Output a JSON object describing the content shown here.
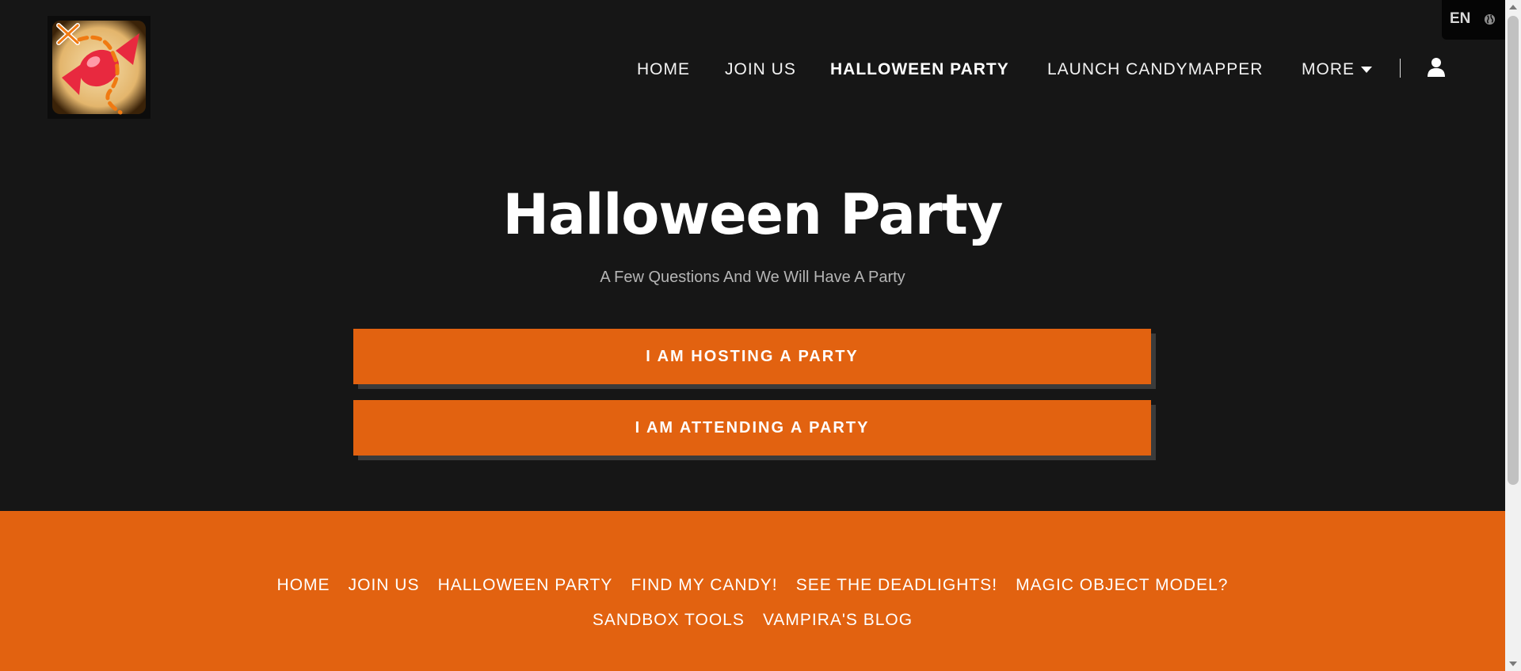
{
  "header": {
    "logo_icon": "candy-map-logo-icon",
    "nav": {
      "home": "HOME",
      "join_us": "JOIN US",
      "halloween_party": "HALLOWEEN PARTY",
      "launch": "LAUNCH CANDYMAPPER",
      "more": "MORE"
    },
    "active_item": "HALLOWEEN PARTY",
    "account_icon": "user-icon",
    "language": {
      "label": "EN",
      "icon": "globe-icon"
    }
  },
  "hero": {
    "title": "Halloween Party",
    "subtitle": "A Few Questions And We Will Have A Party",
    "buttons": {
      "host": "I AM HOSTING A PARTY",
      "attend": "I AM ATTENDING A PARTY"
    }
  },
  "footer": {
    "links_row1": [
      "HOME",
      "JOIN US",
      "HALLOWEEN PARTY",
      "FIND MY CANDY!",
      "SEE THE DEADLIGHTS!",
      "MAGIC OBJECT MODEL?"
    ],
    "links_row2": [
      "SANDBOX TOOLS",
      "VAMPIRA'S BLOG"
    ]
  },
  "colors": {
    "background": "#161616",
    "accent_orange": "#e26210",
    "button_shadow": "#3b3b3b",
    "subtitle_gray": "#b5b5b5"
  }
}
